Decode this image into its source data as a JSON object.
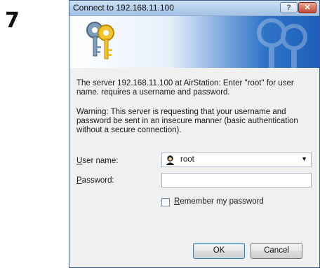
{
  "step": {
    "number": "7"
  },
  "dialog": {
    "title": "Connect to 192.168.11.100",
    "help_button": "?",
    "close_button": "✕",
    "server_message": "The server 192.168.11.100 at AirStation: Enter \"root\" for user name. requires a username and password.",
    "warning_message": "Warning: This server is requesting that your username and password be sent in an insecure manner (basic authentication without a secure connection).",
    "username": {
      "label_first": "U",
      "label_rest": "ser name:",
      "value": "root"
    },
    "password": {
      "label_first": "P",
      "label_rest": "assword:",
      "value": ""
    },
    "remember": {
      "label_first": "R",
      "label_rest": "emember my password",
      "checked": false
    },
    "ok_label": "OK",
    "cancel_label": "Cancel"
  },
  "icons": {
    "banner": "keys-icon",
    "avatar": "user-avatar-icon",
    "dropdown": "chevron-down-icon"
  }
}
